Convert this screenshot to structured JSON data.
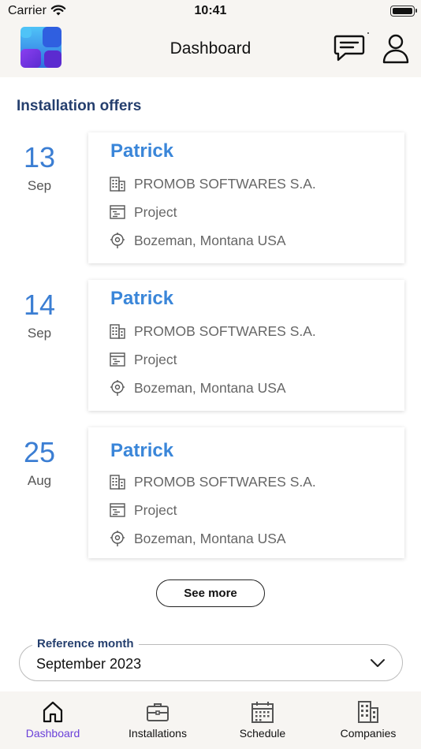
{
  "status_bar": {
    "carrier": "Carrier",
    "time": "10:41"
  },
  "header": {
    "title": "Dashboard",
    "icons": {
      "logo": "app-logo",
      "chat": "chat-icon",
      "profile": "user-icon"
    }
  },
  "section": {
    "title": "Installation offers"
  },
  "offers": [
    {
      "day": "13",
      "month": "Sep",
      "name": "Patrick",
      "company": "PROMOB SOFTWARES S.A.",
      "type": "Project",
      "location": "Bozeman, Montana USA"
    },
    {
      "day": "14",
      "month": "Sep",
      "name": "Patrick",
      "company": "PROMOB SOFTWARES S.A.",
      "type": "Project",
      "location": "Bozeman, Montana USA"
    },
    {
      "day": "25",
      "month": "Aug",
      "name": "Patrick",
      "company": "PROMOB SOFTWARES S.A.",
      "type": "Project",
      "location": "Bozeman, Montana USA"
    }
  ],
  "see_more": {
    "label": "See more"
  },
  "reference_month": {
    "label": "Reference month",
    "value": "September 2023"
  },
  "tabs": [
    {
      "label": "Dashboard",
      "icon": "home-icon",
      "active": true
    },
    {
      "label": "Installations",
      "icon": "briefcase-icon",
      "active": false
    },
    {
      "label": "Schedule",
      "icon": "calendar-icon",
      "active": false
    },
    {
      "label": "Companies",
      "icon": "building-icon",
      "active": false
    }
  ],
  "colors": {
    "accent": "#6a40d9",
    "name_blue": "#3a86d9",
    "date_blue": "#3b7ed3",
    "title_navy": "#253f6e",
    "background": "#f7f5f2"
  }
}
